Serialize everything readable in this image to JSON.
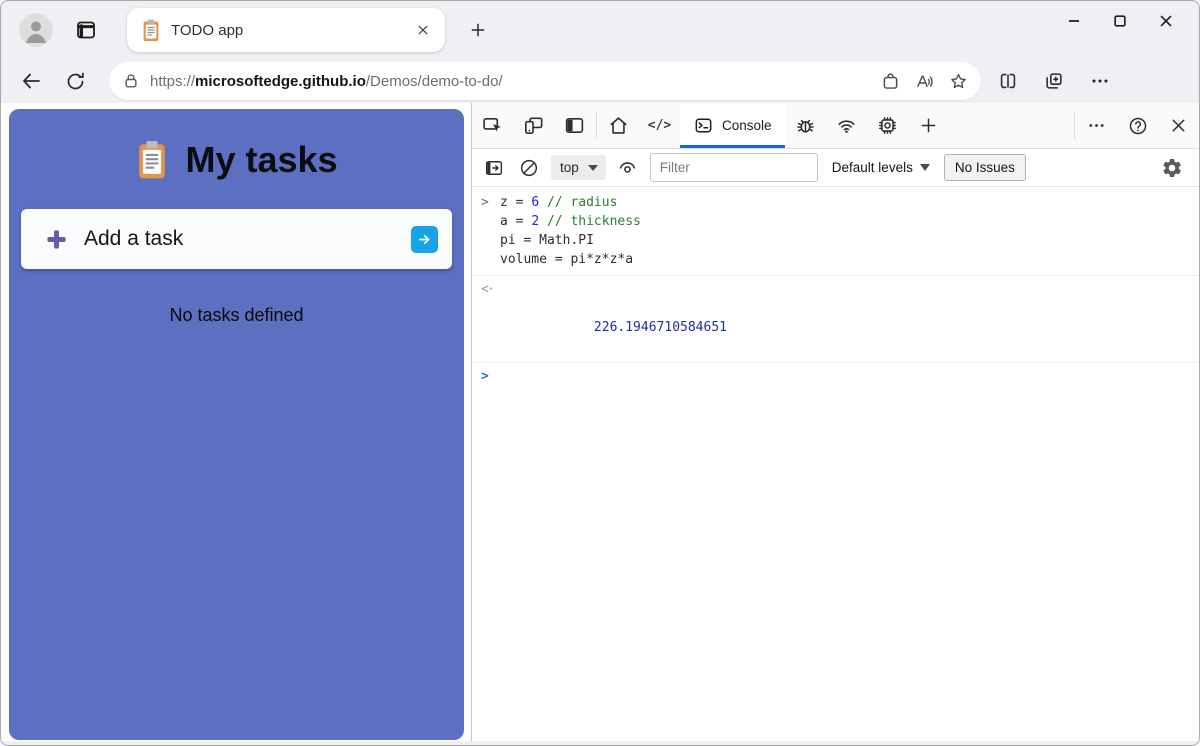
{
  "browser": {
    "tab_title": "TODO app",
    "url": {
      "scheme": "https://",
      "host": "microsoftedge.github.io",
      "path": "/Demos/demo-to-do/"
    }
  },
  "todo_app": {
    "title": "My tasks",
    "add_task_label": "Add a task",
    "empty_message": "No tasks defined"
  },
  "devtools": {
    "tabs": {
      "console": "Console"
    },
    "toolbar": {
      "context": "top",
      "filter_placeholder": "Filter",
      "default_levels": "Default levels",
      "no_issues": "No Issues"
    },
    "console": {
      "input_lines": [
        [
          {
            "t": "z = ",
            "c": "plain"
          },
          {
            "t": "6",
            "c": "number"
          },
          {
            "t": " ",
            "c": "plain"
          },
          {
            "t": "// radius",
            "c": "comment"
          }
        ],
        [
          {
            "t": "a = ",
            "c": "plain"
          },
          {
            "t": "2",
            "c": "number"
          },
          {
            "t": " ",
            "c": "plain"
          },
          {
            "t": "// thickness",
            "c": "comment"
          }
        ],
        [
          {
            "t": "pi = Math.PI",
            "c": "plain"
          }
        ],
        [
          {
            "t": "volume = pi*z*z*a",
            "c": "plain"
          }
        ]
      ],
      "result": "226.1946710584651"
    }
  },
  "icons": {
    "sources_glyph": "</>",
    "input_chevron": ">",
    "prompt_chevron": ">",
    "return_glyph": "<·"
  },
  "colors": {
    "app_background": "#5c6fc0",
    "go_button": "#16a3e8",
    "devtools_accent": "#1567d3",
    "code_number": "#2222d6",
    "code_comment": "#2e7d32",
    "code_result": "#1f2f9e",
    "prompt_blue": "#1f73d2"
  }
}
